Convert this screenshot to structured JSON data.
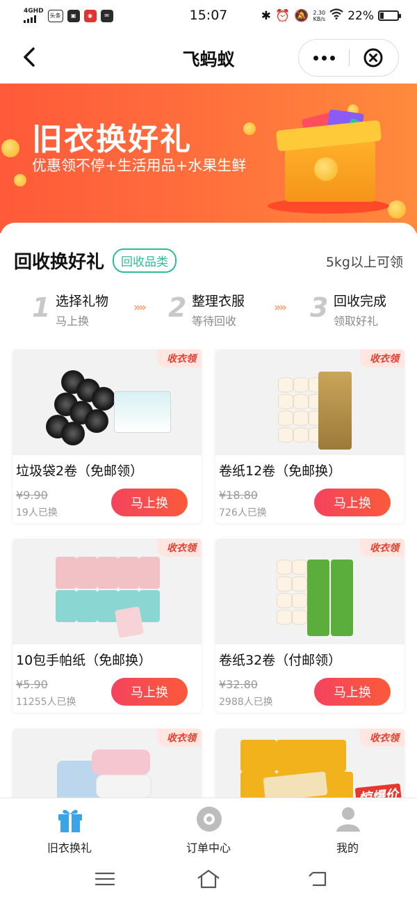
{
  "status_bar": {
    "network": "4GHD",
    "app_badges": [
      "头条",
      "",
      "",
      ""
    ],
    "time": "15:07",
    "speed": "2.30",
    "speed_unit": "KB/s",
    "battery": "22%",
    "battery_level": 0.22
  },
  "nav": {
    "title": "飞蚂蚁",
    "back_icon": "back-arrow-icon",
    "more_icon": "more-dots-icon",
    "close_icon": "close-circle-icon"
  },
  "banner": {
    "title": "旧衣换好礼",
    "subtitle": "优惠领不停+生活用品+水果生鲜"
  },
  "section": {
    "title": "回收换好礼",
    "category_tag": "回收品类",
    "right_note": "5kg以上可领"
  },
  "steps": [
    {
      "num": "1",
      "title": "选择礼物",
      "sub": "马上换"
    },
    {
      "num": "2",
      "title": "整理衣服",
      "sub": "等待回收"
    },
    {
      "num": "3",
      "title": "回收完成",
      "sub": "领取好礼"
    }
  ],
  "step_arrow": "»»",
  "products": [
    {
      "tag": "收衣领",
      "name": "垃圾袋2卷（免邮领）",
      "price": "¥9.90",
      "count": "19人已换",
      "button": "马上换"
    },
    {
      "tag": "收衣领",
      "name": "卷纸12卷（免邮换）",
      "price": "¥18.80",
      "count": "726人已换",
      "button": "马上换"
    },
    {
      "tag": "收衣领",
      "name": "10包手帕纸（免邮换）",
      "price": "¥5.90",
      "count": "11255人已换",
      "button": "马上换"
    },
    {
      "tag": "收衣领",
      "name": "卷纸32卷（付邮领）",
      "price": "¥32.80",
      "count": "2988人已换",
      "button": "马上换"
    },
    {
      "tag": "收衣领"
    },
    {
      "tag": "收衣领",
      "badge": "惊爆价"
    }
  ],
  "tabbar": [
    {
      "label": "旧衣换礼",
      "icon": "gift-icon",
      "active": true
    },
    {
      "label": "订单中心",
      "icon": "order-icon",
      "active": false
    },
    {
      "label": "我的",
      "icon": "user-icon",
      "active": false
    }
  ],
  "colors": {
    "accent_red": "#f4435e",
    "banner_orange": "#ff6d3c",
    "tag_green": "#2cbd95",
    "tab_active_blue": "#3ba3e8"
  }
}
